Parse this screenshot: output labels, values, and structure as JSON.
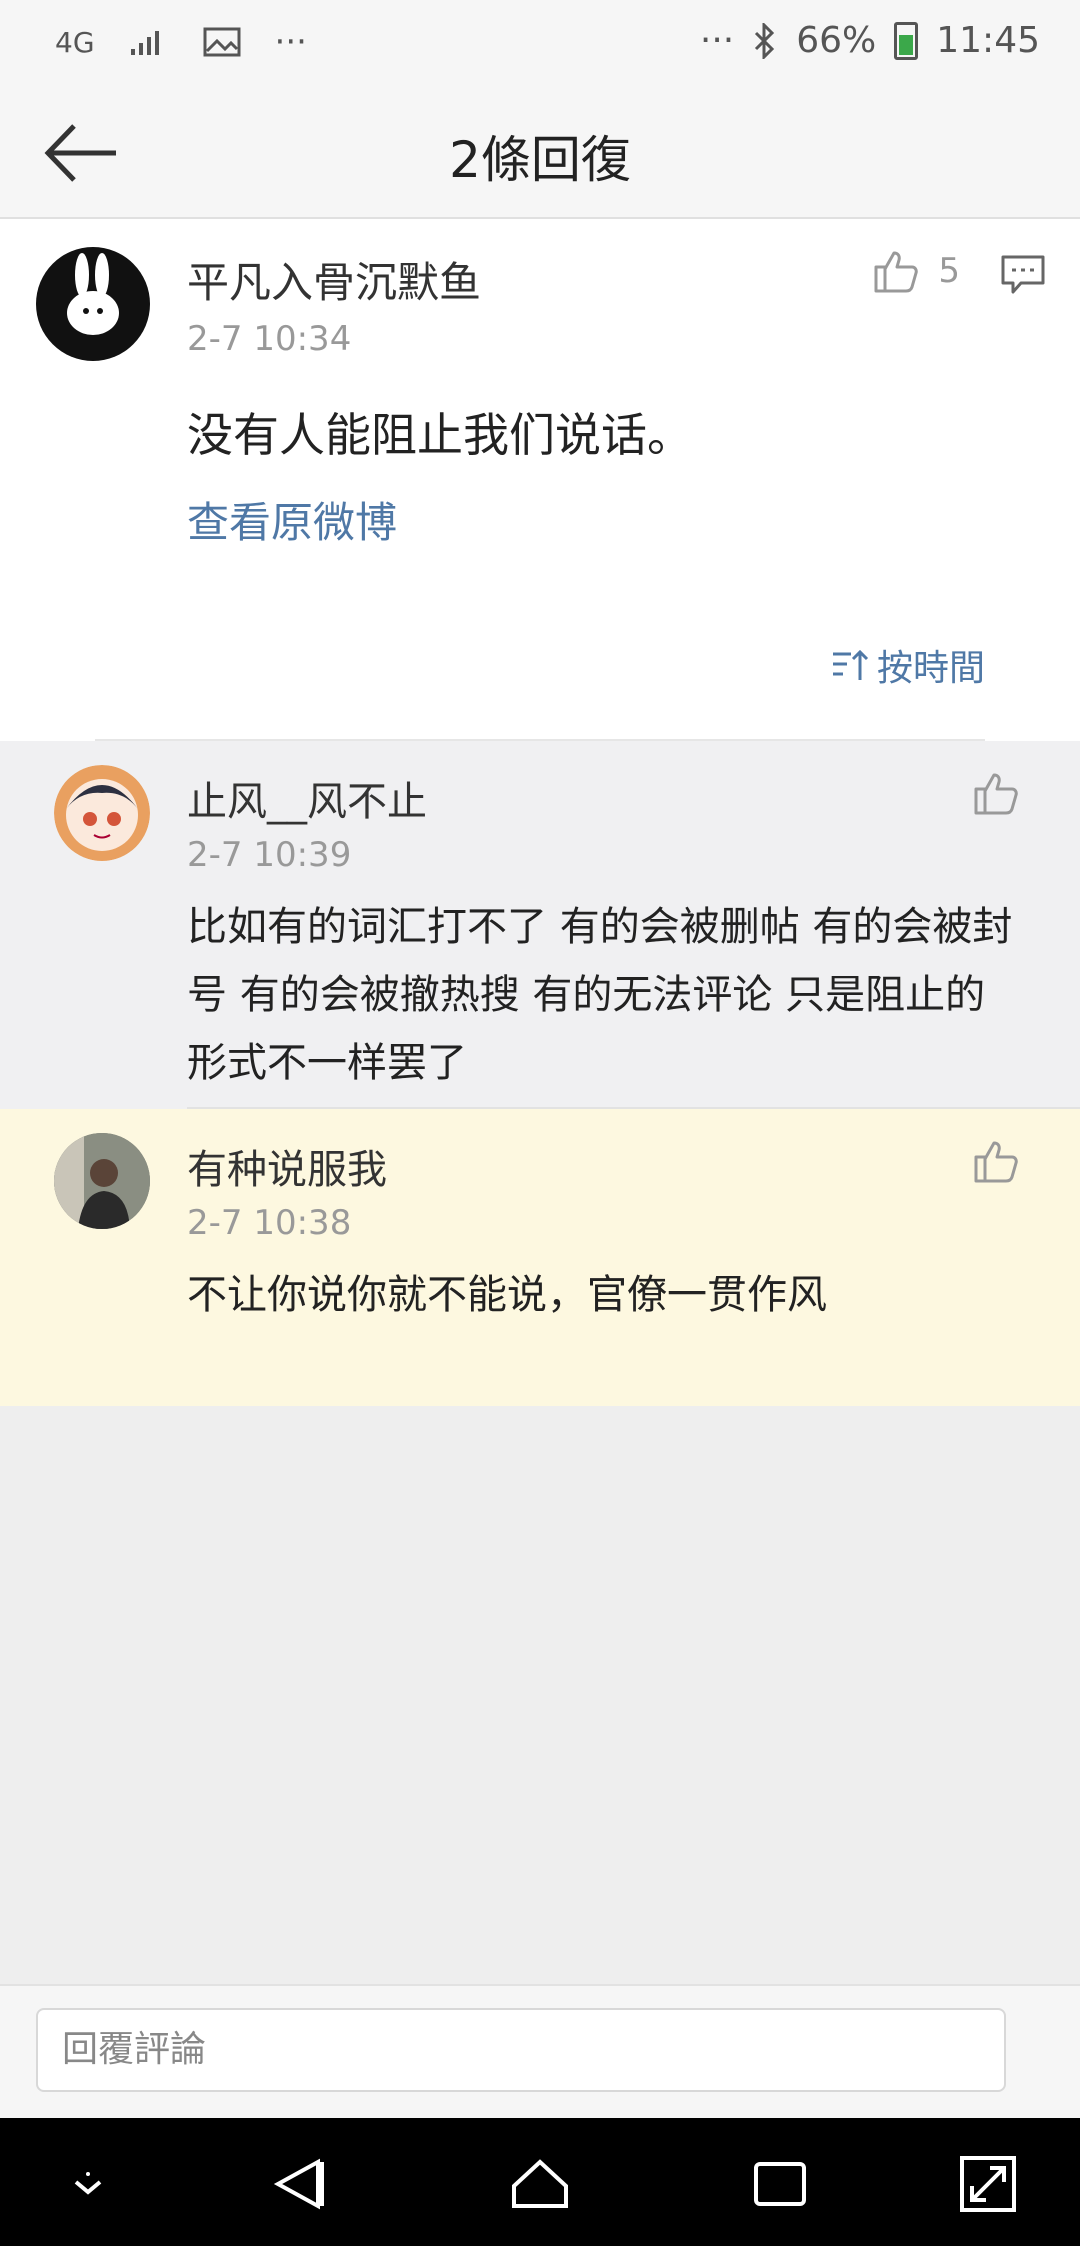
{
  "status_bar": {
    "network": "4G",
    "battery": "66%",
    "time": "11:45",
    "dots": "···"
  },
  "header": {
    "title": "2條回復"
  },
  "main_post": {
    "user": "平凡入骨沉默鱼",
    "time": "2-7 10:34",
    "likes": "5",
    "text": "没有人能阻止我们说话。",
    "view_original": "查看原微博",
    "sort_label": "按時間"
  },
  "replies": [
    {
      "user": "止风__风不止",
      "time": "2-7 10:39",
      "text": "比如有的词汇打不了 有的会被删帖 有的会被封号 有的会被撤热搜  有的无法评论  只是阻止的形式不一样罢了"
    },
    {
      "user": "有种说服我",
      "time": "2-7 10:38",
      "text": "不让你说你就不能说，官僚一贯作风"
    }
  ],
  "composer": {
    "placeholder": "回覆評論"
  },
  "colors": {
    "link": "#4f78a6",
    "highlight_bg": "#fdf8e0",
    "battery": "#3ba84a"
  }
}
